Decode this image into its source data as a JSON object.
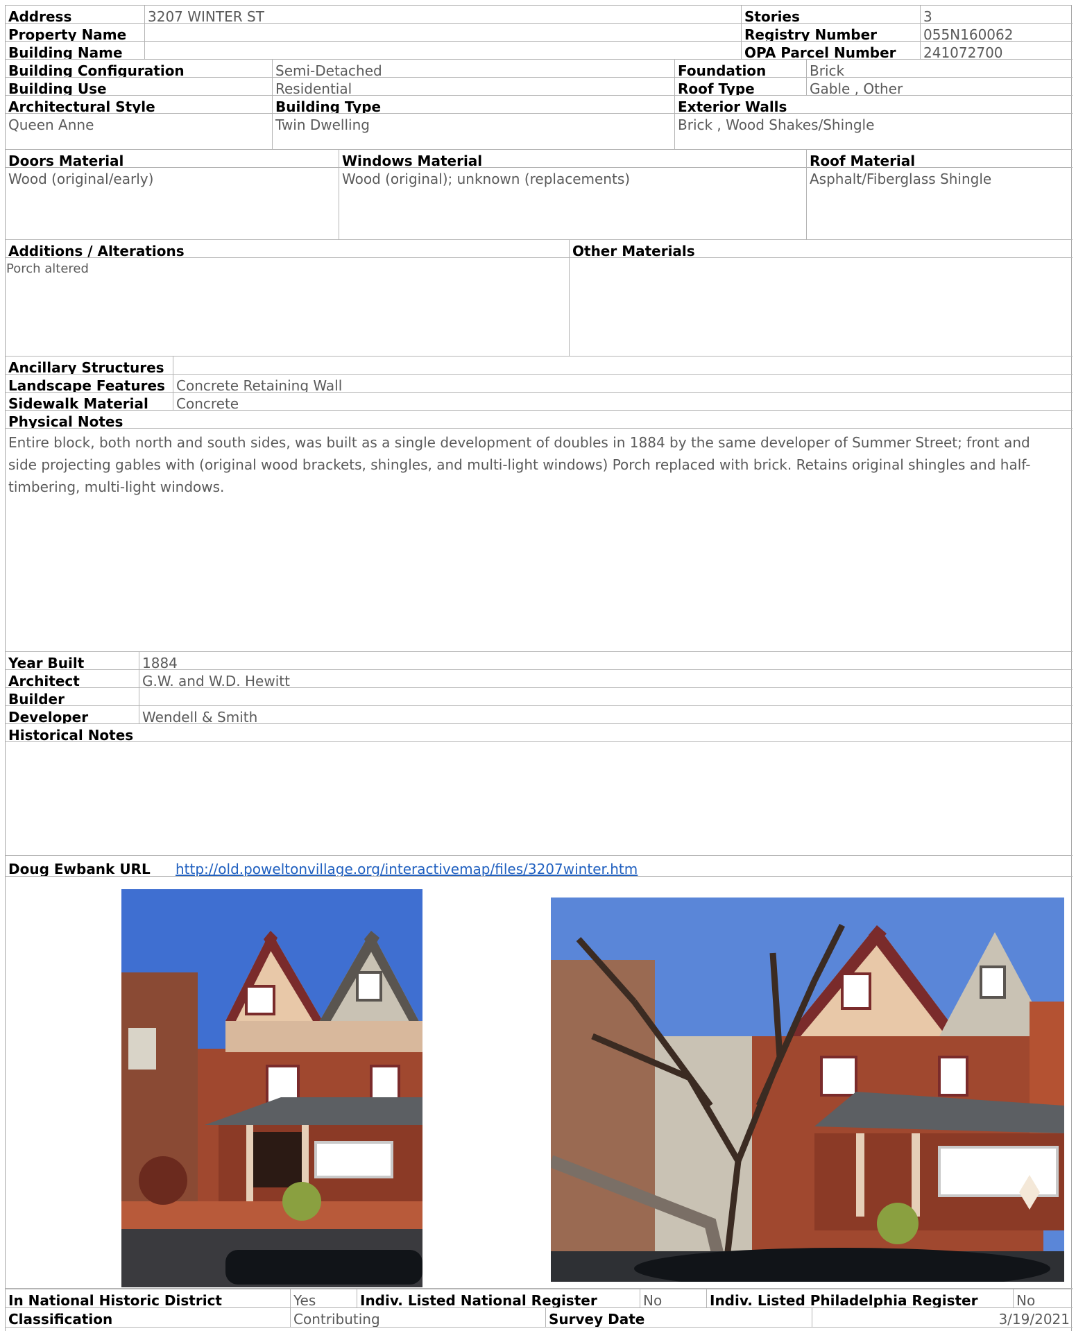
{
  "property": {
    "address_label": "Address",
    "address": "3207 WINTER ST",
    "stories_label": "Stories",
    "stories": "3",
    "property_name_label": "Property Name",
    "property_name": "",
    "registry_number_label": "Registry Number",
    "registry_number": "055N160062",
    "building_name_label": "Building Name",
    "building_name": "",
    "opa_label": "OPA Parcel Number",
    "opa": "241072700"
  },
  "building": {
    "config_label": "Building Configuration",
    "config": "Semi-Detached",
    "foundation_label": "Foundation",
    "foundation": "Brick",
    "use_label": "Building Use",
    "use": "Residential",
    "roof_type_label": "Roof Type",
    "roof_type": "Gable , Other",
    "style_label": "Architectural Style",
    "style": "Queen Anne",
    "type_label": "Building Type",
    "type": "Twin Dwelling",
    "walls_label": "Exterior Walls",
    "walls": "Brick , Wood Shakes/Shingle"
  },
  "materials": {
    "doors_label": "Doors Material",
    "doors": "Wood (original/early)",
    "windows_label": "Windows Material",
    "windows": "Wood (original); unknown (replacements)",
    "roof_label": "Roof Material",
    "roof": "Asphalt/Fiberglass Shingle"
  },
  "additions": {
    "additions_label": "Additions / Alterations",
    "additions": "Porch altered",
    "other_label": "Other Materials",
    "other": ""
  },
  "site": {
    "ancillary_label": "Ancillary Structures",
    "ancillary": "",
    "landscape_label": "Landscape Features",
    "landscape": "Concrete Retaining Wall",
    "sidewalk_label": "Sidewalk Material",
    "sidewalk": "Concrete"
  },
  "physical_notes": {
    "label": "Physical Notes",
    "text": "Entire block, both north and south sides, was built as a single development of doubles in 1884 by the same developer of Summer Street; front and side projecting gables with (original wood brackets, shingles, and multi-light windows)  Porch replaced with brick. Retains original shingles and half-timbering, multi-light windows."
  },
  "history": {
    "year_label": "Year Built",
    "year": "1884",
    "architect_label": "Architect",
    "architect": "G.W. and W.D. Hewitt",
    "builder_label": "Builder",
    "builder": "",
    "developer_label": "Developer",
    "developer": "Wendell & Smith",
    "notes_label": "Historical Notes",
    "notes": ""
  },
  "url": {
    "label": "Doug Ewbank URL",
    "link": "http://old.poweltonvillage.org/interactivemap/files/3207winter.htm"
  },
  "photos": [
    {
      "name": "front-view",
      "sky": "#3f6fd1"
    },
    {
      "name": "angled-view",
      "sky": "#5a86d8"
    }
  ],
  "status": {
    "district_label": "In National Historic District",
    "district": "Yes",
    "national_label": "Indiv. Listed National Register",
    "national": "No",
    "phila_label": "Indiv. Listed Philadelphia Register",
    "phila": "No",
    "class_label": "Classification",
    "class": "Contributing",
    "survey_label": "Survey Date",
    "survey": "3/19/2021"
  }
}
